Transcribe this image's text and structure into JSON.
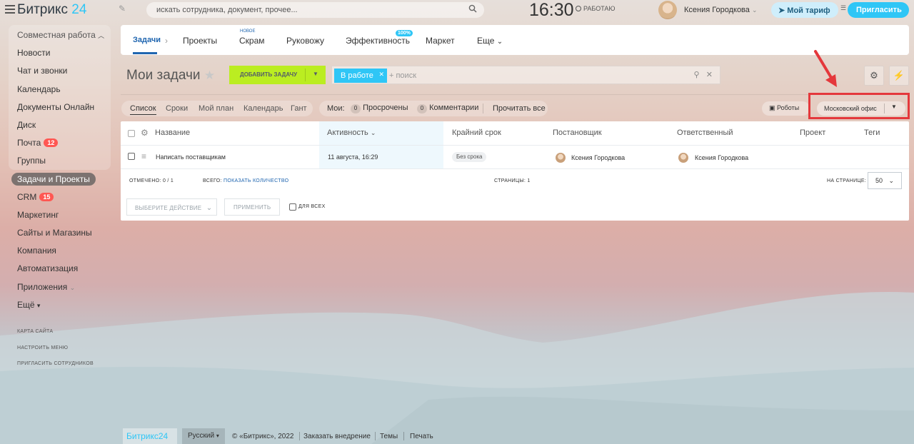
{
  "topbar": {
    "logo_main": "Битрикс",
    "logo_num": "24",
    "search_placeholder": "искать сотрудника, документ, прочее...",
    "clock": "16:30",
    "work_status": "РАБОТАЮ",
    "user_name": "Ксения Городкова",
    "tariff_label": "Мой тариф",
    "invite_label": "Пригласить"
  },
  "sidebar": {
    "group_label": "Совместная работа",
    "items": [
      {
        "label": "Новости"
      },
      {
        "label": "Чат и звонки"
      },
      {
        "label": "Календарь"
      },
      {
        "label": "Документы Онлайн"
      },
      {
        "label": "Диск"
      },
      {
        "label": "Почта",
        "badge": "12"
      },
      {
        "label": "Группы"
      },
      {
        "label": "Задачи и Проекты"
      },
      {
        "label": "CRM",
        "badge": "15"
      },
      {
        "label": "Маркетинг"
      },
      {
        "label": "Сайты и Магазины"
      },
      {
        "label": "Компания"
      },
      {
        "label": "Автоматизация"
      },
      {
        "label": "Приложения"
      },
      {
        "label": "Ещё"
      }
    ],
    "mini": [
      "КАРТА САЙТА",
      "НАСТРОИТЬ МЕНЮ",
      "ПРИГЛАСИТЬ СОТРУДНИКОВ"
    ]
  },
  "tabs": {
    "items": [
      "Задачи",
      "Проекты",
      "Скрам",
      "Руковожу",
      "Эффективность",
      "Маркет",
      "Еще"
    ],
    "new_tag": "НОВОЕ",
    "pct_tag": "100%"
  },
  "toolbar": {
    "page_title": "Мои задачи",
    "add_task_label": "ДОБАВИТЬ ЗАДАЧУ",
    "filter_chip": "В работе",
    "filter_placeholder": "+ поиск"
  },
  "views": {
    "items": [
      "Список",
      "Сроки",
      "Мой план",
      "Календарь",
      "Гант"
    ],
    "my_label": "Мои:",
    "overdue_count": "0",
    "overdue_label": "Просрочены",
    "comments_count": "0",
    "comments_label": "Комментарии",
    "read_all_label": "Прочитать все",
    "robots_label": "Роботы",
    "office_label": "Московский офис"
  },
  "grid": {
    "columns": [
      "Название",
      "Активность",
      "Крайний срок",
      "Постановщик",
      "Ответственный",
      "Проект",
      "Теги"
    ],
    "rows": [
      {
        "name": "Написать поставщикам",
        "activity": "11 августа, 16:29",
        "deadline": "Без срока",
        "creator": "Ксения Городкова",
        "responsible": "Ксения Городкова"
      }
    ],
    "marked": "ОТМЕЧЕНО: 0 / 1",
    "total_label": "ВСЕГО:",
    "total_link": "ПОКАЗАТЬ КОЛИЧЕСТВО",
    "pages": "СТРАНИЦЫ: 1",
    "per_page_label": "НА СТРАНИЦЕ:",
    "per_page_value": "50",
    "action_select": "ВЫБЕРИТЕ ДЕЙСТВИЕ",
    "apply_label": "ПРИМЕНИТЬ",
    "for_all_label": "ДЛЯ ВСЕХ"
  },
  "footer": {
    "logo": "Битрикс24",
    "lang": "Русский",
    "copyright": "© «Битрикс», 2022",
    "order": "Заказать внедрение",
    "themes": "Темы",
    "print": "Печать"
  },
  "colors": {
    "accent": "#2fc6f6",
    "add_button": "#bbed21",
    "highlight": "#e4383c",
    "link": "#2066b0"
  }
}
